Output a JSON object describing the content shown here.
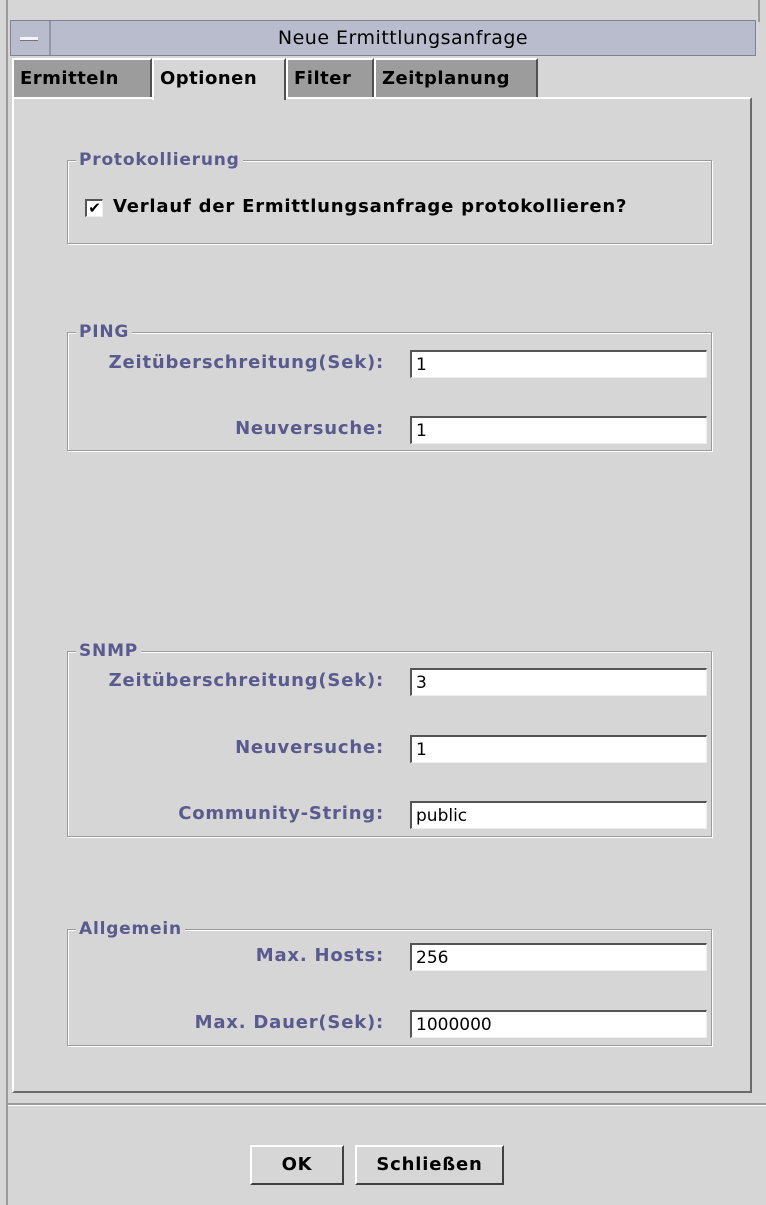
{
  "window": {
    "title": "Neue Ermittlungsanfrage"
  },
  "tabs": [
    {
      "label": "Ermitteln"
    },
    {
      "label": "Optionen"
    },
    {
      "label": "Filter"
    },
    {
      "label": "Zeitplanung"
    }
  ],
  "active_tab": "Optionen",
  "logging": {
    "title": "Protokollierung",
    "checkbox_label": "Verlauf der Ermittlungsanfrage protokollieren?",
    "checked": true,
    "check_glyph": "✔"
  },
  "ping": {
    "title": "PING",
    "timeout_label": "Zeitüberschreitung(Sek):",
    "timeout_value": "1",
    "retries_label": "Neuversuche:",
    "retries_value": "1"
  },
  "snmp": {
    "title": "SNMP",
    "timeout_label": "Zeitüberschreitung(Sek):",
    "timeout_value": "3",
    "retries_label": "Neuversuche:",
    "retries_value": "1",
    "community_label": "Community-String:",
    "community_value": "public"
  },
  "general": {
    "title": "Allgemein",
    "max_hosts_label": "Max. Hosts:",
    "max_hosts_value": "256",
    "max_duration_label": "Max. Dauer(Sek):",
    "max_duration_value": "1000000"
  },
  "buttons": {
    "ok": "OK",
    "close": "Schließen"
  },
  "icons": {
    "window_menu": "window-menu-icon",
    "checkbox_check": "check-icon"
  },
  "colors": {
    "label": "#5a5a8e",
    "background": "#d6d6d6",
    "title_bar": "#b8bccc"
  }
}
